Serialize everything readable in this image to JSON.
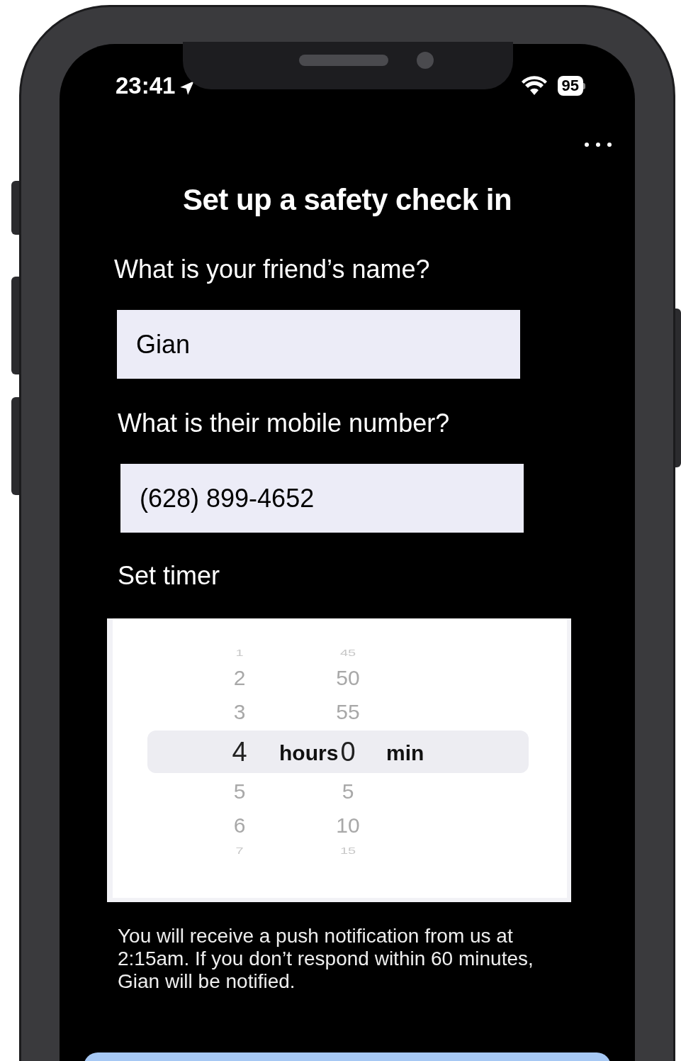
{
  "status_bar": {
    "time": "23:41",
    "battery": "95"
  },
  "title": "Set up a safety check in",
  "fields": [
    {
      "label": "What is your friend’s name?",
      "value": "Gian"
    },
    {
      "label": "What is their mobile number?",
      "value": "(628) 899-4652"
    }
  ],
  "timer": {
    "label": "Set timer",
    "columns": [
      {
        "unit": "hours",
        "items": [
          {
            "text": "1",
            "selected": false
          },
          {
            "text": "2",
            "selected": false
          },
          {
            "text": "3",
            "selected": false
          },
          {
            "text": "4",
            "selected": true
          },
          {
            "text": "5",
            "selected": false
          },
          {
            "text": "6",
            "selected": false
          },
          {
            "text": "7",
            "selected": false
          }
        ]
      },
      {
        "unit": "min",
        "items": [
          {
            "text": "45",
            "selected": false
          },
          {
            "text": "50",
            "selected": false
          },
          {
            "text": "55",
            "selected": false
          },
          {
            "text": "0",
            "selected": true
          },
          {
            "text": "5",
            "selected": false
          },
          {
            "text": "10",
            "selected": false
          },
          {
            "text": "15",
            "selected": false
          }
        ]
      }
    ]
  },
  "notice": "You will receive a push notification from us at 2:15am. If you don’t respond within 60 minutes, Gian will be notified."
}
